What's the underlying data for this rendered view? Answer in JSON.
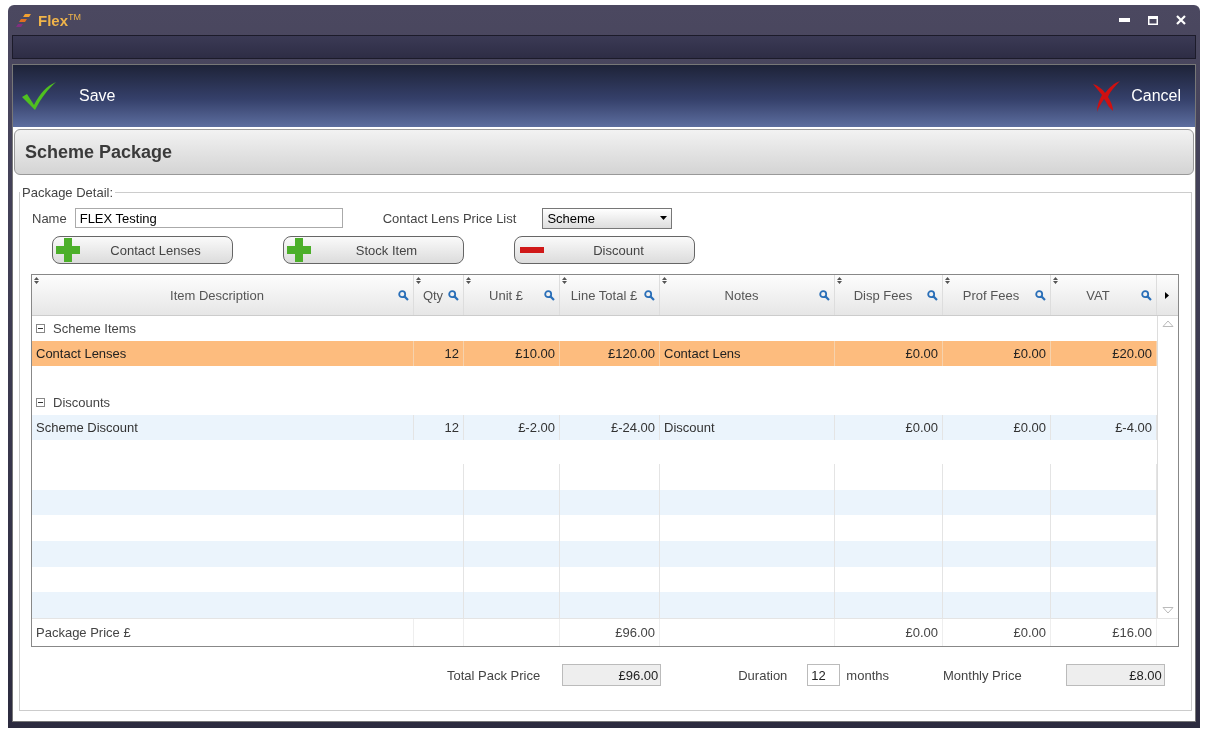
{
  "window": {
    "title": "Flex$^{TM}$"
  },
  "toolbar": {
    "save": "Save",
    "cancel": "Cancel"
  },
  "section_title": "Scheme Package",
  "package_detail": {
    "legend": "Package Detail:",
    "name_label": "Name",
    "name_value": "FLEX Testing",
    "price_list_label": "Contact Lens Price List",
    "price_list_value": "Scheme",
    "buttons": [
      {
        "label": "Contact Lenses",
        "kind": "add"
      },
      {
        "label": "Stock Item",
        "kind": "add"
      },
      {
        "label": "Discount",
        "kind": "remove"
      }
    ]
  },
  "table": {
    "columns": [
      {
        "label": "Item Description",
        "kind": "text"
      },
      {
        "label": "Qty",
        "kind": "number"
      },
      {
        "label": "Unit £",
        "kind": "number"
      },
      {
        "label": "Line Total £",
        "kind": "number"
      },
      {
        "label": "Notes",
        "kind": "text"
      },
      {
        "label": "Disp Fees",
        "kind": "number"
      },
      {
        "label": "Prof Fees",
        "kind": "number"
      },
      {
        "label": "VAT",
        "kind": "number"
      }
    ],
    "groups": [
      {
        "label": "Scheme Items",
        "expanded": true,
        "rows": [
          {
            "selected": true,
            "cells": [
              "Contact Lenses",
              "12",
              "£10.00",
              "£120.00",
              "Contact Lens",
              "£0.00",
              "£0.00",
              "£20.00"
            ]
          }
        ]
      },
      {
        "label": "Discounts",
        "expanded": true,
        "rows": [
          {
            "selected": false,
            "cells": [
              "Scheme Discount",
              "12",
              "£-2.00",
              "£-24.00",
              "Discount",
              "£0.00",
              "£0.00",
              "£-4.00"
            ]
          }
        ]
      }
    ],
    "footer": {
      "label": "Package Price £",
      "line_total": "£96.00",
      "disp_fees": "£0.00",
      "prof_fees": "£0.00",
      "vat": "£16.00"
    }
  },
  "summary": {
    "total_label": "Total Pack Price",
    "total_value": "£96.00",
    "duration_label": "Duration",
    "duration_value": "12",
    "duration_unit": "months",
    "monthly_label": "Monthly Price",
    "monthly_value": "£8.00"
  }
}
